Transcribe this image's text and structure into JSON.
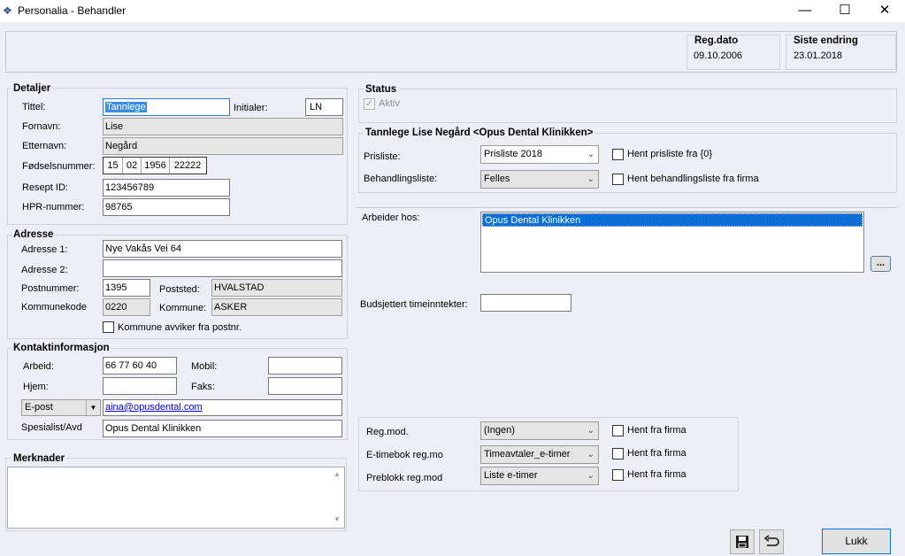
{
  "window": {
    "title": "Personalia - Behandler",
    "minimize": "—",
    "maximize": "☐",
    "close": "✕"
  },
  "header": {
    "reg_dato_label": "Reg.dato",
    "reg_dato": "09.10.2006",
    "siste_endring_label": "Siste endring",
    "siste_endring": "23.01.2018"
  },
  "detaljer": {
    "title": "Detaljer",
    "tittel_label": "Tittel:",
    "tittel": "Tannlege",
    "initialer_label": "Initialer:",
    "initialer": "LN",
    "fornavn_label": "Fornavn:",
    "fornavn": "Lise",
    "etternavn_label": "Etternavn:",
    "etternavn": "Negård",
    "fodselsnummer_label": "Fødselsnummer:",
    "fodselsnummer": [
      "15",
      "02",
      "1956",
      "22222"
    ],
    "resept_label": "Resept ID:",
    "resept": "123456789",
    "hpr_label": "HPR-nummer:",
    "hpr": "98765"
  },
  "adresse": {
    "title": "Adresse",
    "adresse1_label": "Adresse 1:",
    "adresse1": "Nye Vakås Vei 64",
    "adresse2_label": "Adresse 2:",
    "adresse2": "",
    "postnummer_label": "Postnummer:",
    "postnummer": "1395",
    "poststed_label": "Poststed:",
    "poststed": "HVALSTAD",
    "kommunekode_label": "Kommunekode",
    "kommunekode": "0220",
    "kommune_label": "Kommune:",
    "kommune": "ASKER",
    "kommune_avviker_label": "Kommune avviker fra postnr."
  },
  "kontakt": {
    "title": "Kontaktinformasjon",
    "arbeid_label": "Arbeid:",
    "arbeid": "66 77 60 40",
    "mobil_label": "Mobil:",
    "mobil": "",
    "hjem_label": "Hjem:",
    "hjem": "",
    "faks_label": "Faks:",
    "faks": "",
    "epost_type": "E-post",
    "epost": "aina@opusdental.com",
    "spesialist_label": "Spesialist/Avd",
    "spesialist": "Opus Dental Klinikken"
  },
  "merknader": {
    "title": "Merknader",
    "text": ""
  },
  "status": {
    "title": "Status",
    "aktiv_label": "Aktiv",
    "aktiv_checked": true
  },
  "klinikk": {
    "title": "Tannlege Lise Negård <Opus Dental Klinikken>",
    "prisliste_label": "Prisliste:",
    "prisliste": "Prisliste 2018",
    "hent_prisliste_label": "Hent prisliste fra {0}",
    "behandlingsliste_label": "Behandlingsliste:",
    "behandlingsliste": "Felles",
    "hent_behandlingsliste_label": "Hent behandlingsliste fra firma"
  },
  "arbeider": {
    "label": "Arbeider hos:",
    "items": [
      "Opus Dental Klinikken"
    ],
    "browse_label": "..."
  },
  "budsjett": {
    "label": "Budsjettert timeinntekter:",
    "value": ""
  },
  "regmod": {
    "rows": [
      {
        "label": "Reg.mod.",
        "value": "(Ingen)",
        "hent_label": "Hent fra firma"
      },
      {
        "label": "E-timebok reg.mo",
        "value": "Timeavtaler_e-timer",
        "hent_label": "Hent fra firma"
      },
      {
        "label": "Preblokk reg.mod",
        "value": "Liste e-timer",
        "hent_label": "Hent fra firma"
      }
    ]
  },
  "footer": {
    "lukk_label": "Lukk"
  },
  "icons": {
    "save": "save-icon",
    "undo": "undo-icon",
    "dropdown": "chevron-down-icon"
  }
}
